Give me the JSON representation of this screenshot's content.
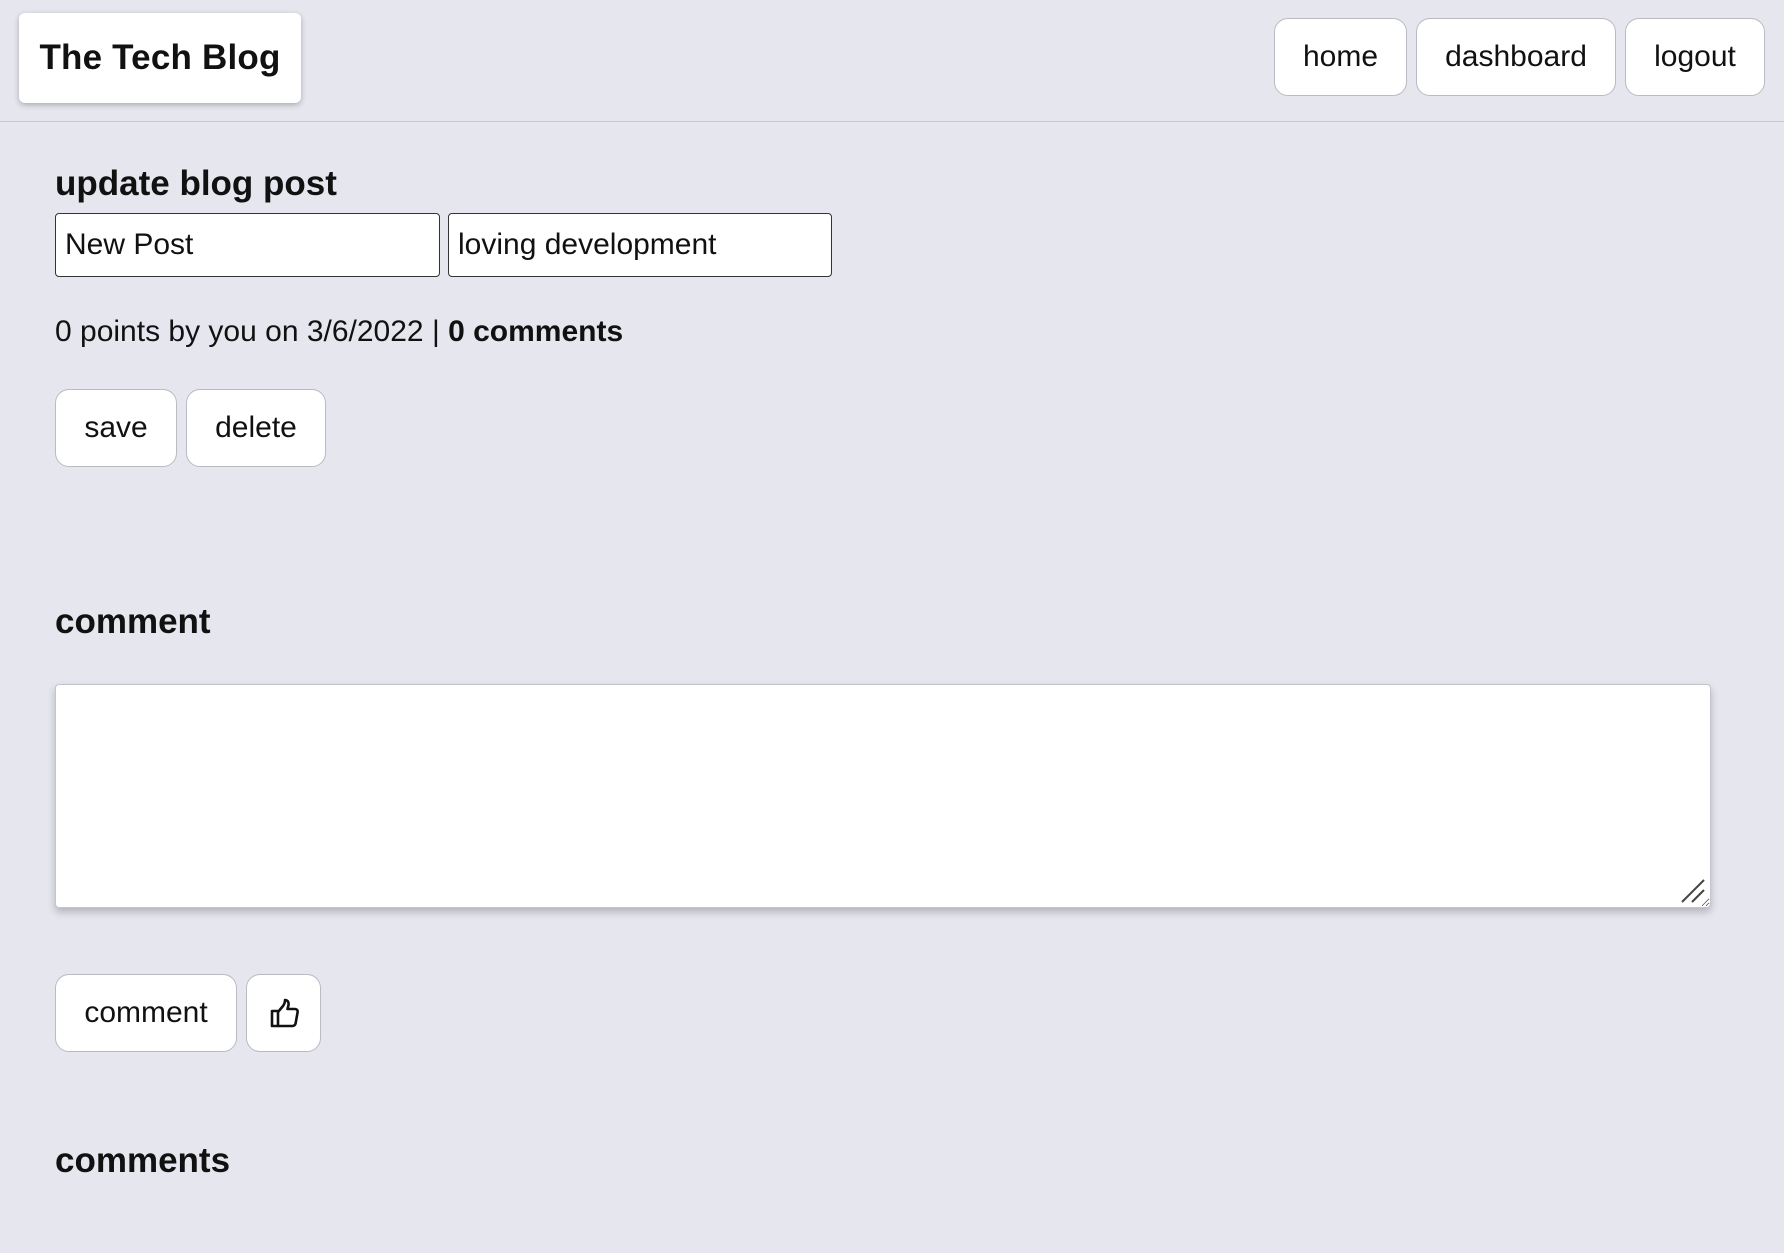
{
  "header": {
    "brand": "The Tech Blog",
    "nav": {
      "home": "home",
      "dashboard": "dashboard",
      "logout": "logout"
    }
  },
  "edit_post": {
    "heading": "update blog post",
    "title_value": "New Post",
    "content_value": "loving development",
    "meta": {
      "points_text": "0 points by you on 3/6/2022 | ",
      "comments_text": "0 comments"
    },
    "save_label": "save",
    "delete_label": "delete"
  },
  "comment_form": {
    "heading": "comment",
    "textarea_value": "",
    "submit_label": "comment",
    "upvote_icon": "thumbs-up-icon"
  },
  "comments_section": {
    "heading": "comments",
    "items": []
  }
}
